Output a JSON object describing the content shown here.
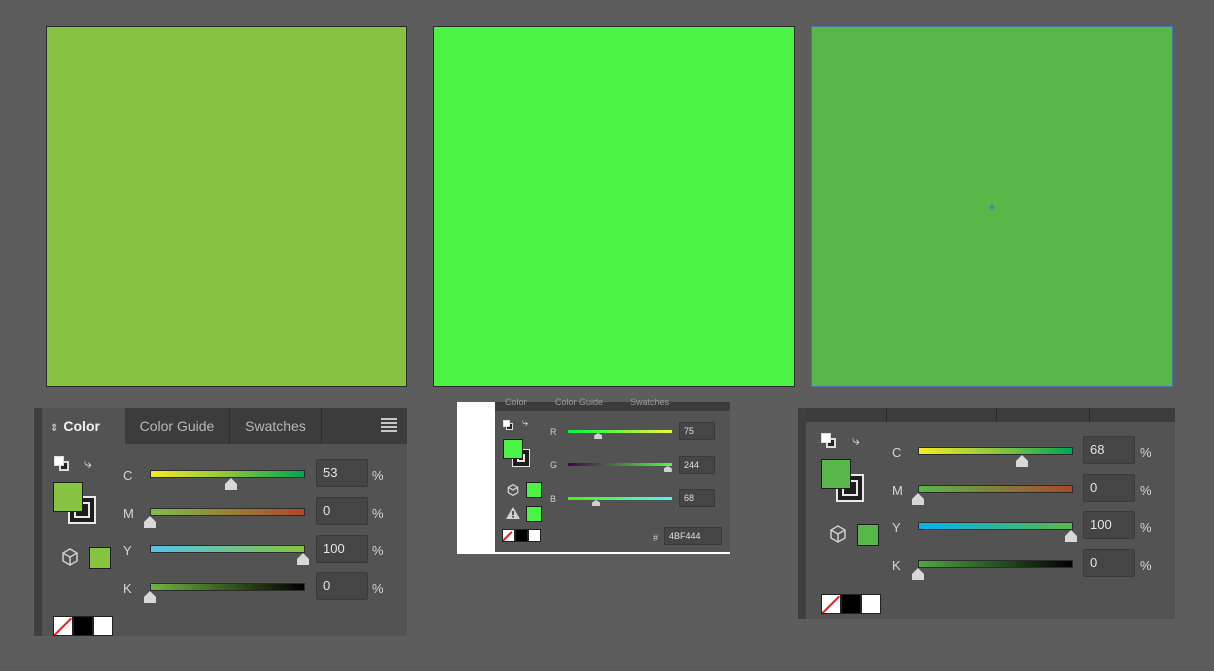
{
  "swatches": {
    "left_color": "#85C341",
    "middle_color": "#4BF444",
    "right_color": "#57B849"
  },
  "panel_cmyk_1": {
    "tabs": [
      "Color",
      "Color Guide",
      "Swatches"
    ],
    "fill_color": "#85C341",
    "channels": [
      {
        "label": "C",
        "value": "53",
        "unit": "%",
        "level": 0.53
      },
      {
        "label": "M",
        "value": "0",
        "unit": "%",
        "level": 0
      },
      {
        "label": "Y",
        "value": "100",
        "unit": "%",
        "level": 1.0
      },
      {
        "label": "K",
        "value": "0",
        "unit": "%",
        "level": 0
      }
    ]
  },
  "panel_rgb": {
    "tabs": [
      "Color",
      "Color Guide",
      "Swatches"
    ],
    "fill_color": "#4BF444",
    "channels": [
      {
        "label": "R",
        "value": "75",
        "level": 0.29
      },
      {
        "label": "G",
        "value": "244",
        "level": 0.96
      },
      {
        "label": "B",
        "value": "68",
        "level": 0.27
      }
    ],
    "hex_label": "#",
    "hex_value": "4BF444"
  },
  "panel_cmyk_2": {
    "fill_color": "#57B849",
    "channels": [
      {
        "label": "C",
        "value": "68",
        "unit": "%",
        "level": 0.68
      },
      {
        "label": "M",
        "value": "0",
        "unit": "%",
        "level": 0
      },
      {
        "label": "Y",
        "value": "100",
        "unit": "%",
        "level": 1.0
      },
      {
        "label": "K",
        "value": "0",
        "unit": "%",
        "level": 0
      }
    ]
  },
  "icons": {
    "swap": "swap-fill-stroke-icon",
    "default": "default-fill-stroke-icon",
    "cube": "out-of-web-color-cube-icon",
    "warning": "out-of-gamut-warning-icon",
    "menu": "panel-menu-icon"
  }
}
